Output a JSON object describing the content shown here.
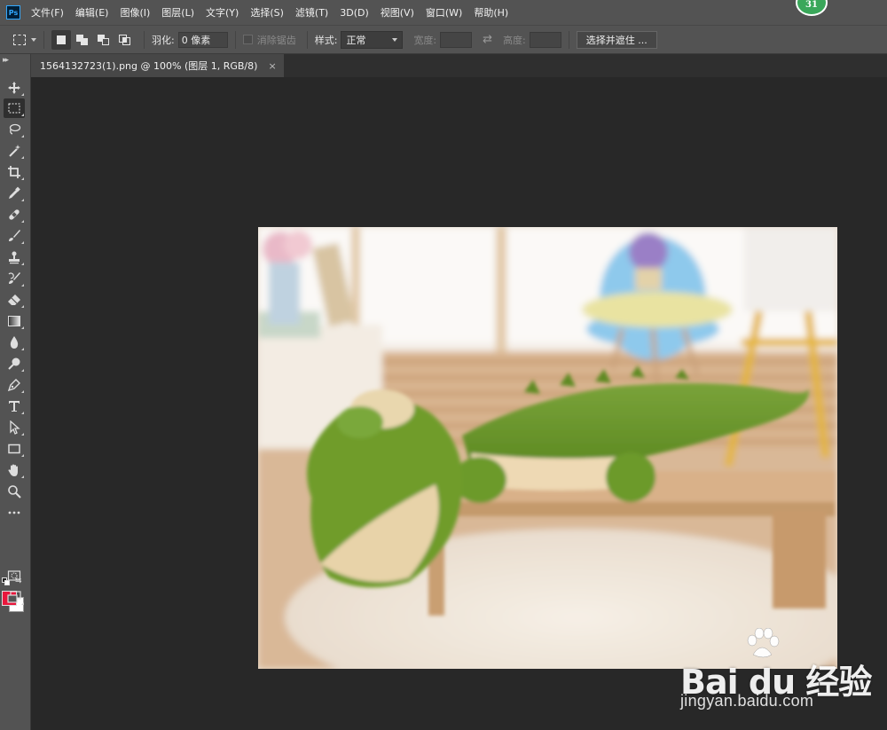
{
  "app": {
    "logo_text": "Ps",
    "notification_count": "31"
  },
  "menubar": {
    "items": [
      {
        "label": "文件(F)"
      },
      {
        "label": "编辑(E)"
      },
      {
        "label": "图像(I)"
      },
      {
        "label": "图层(L)"
      },
      {
        "label": "文字(Y)"
      },
      {
        "label": "选择(S)"
      },
      {
        "label": "滤镜(T)"
      },
      {
        "label": "3D(D)"
      },
      {
        "label": "视图(V)"
      },
      {
        "label": "窗口(W)"
      },
      {
        "label": "帮助(H)"
      }
    ]
  },
  "options": {
    "feather_label": "羽化:",
    "feather_value": "0 像素",
    "antialias_label": "消除锯齿",
    "style_label": "样式:",
    "style_value": "正常",
    "width_label": "宽度:",
    "height_label": "高度:",
    "select_mask_button": "选择并遮住 ..."
  },
  "document": {
    "tab_title": "1564132723(1).png @ 100% (图层 1, RGB/8)",
    "tab_close": "×"
  },
  "toolbar": {
    "tools": [
      "move-tool",
      "rectangular-marquee-tool",
      "lasso-tool",
      "magic-wand-tool",
      "crop-tool",
      "eyedropper-tool",
      "healing-brush-tool",
      "brush-tool",
      "clone-stamp-tool",
      "history-brush-tool",
      "eraser-tool",
      "gradient-tool",
      "blur-tool",
      "dodge-tool",
      "pen-tool",
      "type-tool",
      "path-selection-tool",
      "rectangle-tool",
      "hand-tool",
      "zoom-tool",
      "edit-toolbar"
    ],
    "active_tool": "rectangular-marquee-tool",
    "foreground_color": "#e8173c",
    "background_color": "#ffffff"
  },
  "watermark": {
    "logo_text": "Bai du 经验",
    "url": "jingyan.baidu.com"
  }
}
